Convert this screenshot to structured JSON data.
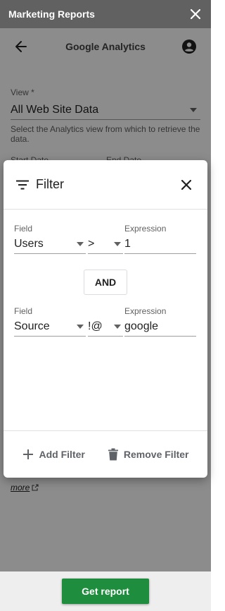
{
  "app": {
    "title": "Marketing Reports"
  },
  "header": {
    "title": "Google Analytics"
  },
  "form": {
    "view_label": "View *",
    "view_value": "All Web Site Data",
    "view_help": "Select the Analytics view from which to retrieve the data.",
    "start_label": "Start Date",
    "end_label": "End Date",
    "more_link": "more"
  },
  "dialog": {
    "title": "Filter",
    "rows": [
      {
        "field_label": "Field",
        "field_value": "Users",
        "operator": ">",
        "expression_label": "Expression",
        "expression_value": "1"
      },
      {
        "field_label": "Field",
        "field_value": "Source",
        "operator": "!@",
        "expression_label": "Expression",
        "expression_value": "google"
      }
    ],
    "and_label": "AND",
    "add_filter_label": "Add Filter",
    "remove_filter_label": "Remove Filter"
  },
  "footer": {
    "get_report_label": "Get report"
  },
  "colors": {
    "titlebar": "#616161",
    "primary_button": "#1e8e3e",
    "overlay": "rgba(0,0,0,0.45)"
  }
}
